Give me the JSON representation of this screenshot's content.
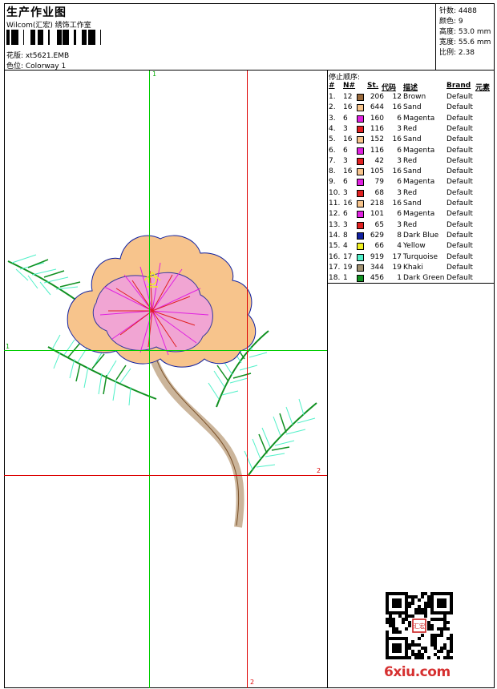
{
  "header": {
    "title": "生产作业图",
    "company": "Wilcom(汇宏) 绣饰工作室",
    "design_file": "花版: xt5621.EMB",
    "colorway": "色位: Colorway 1"
  },
  "stats": [
    {
      "label": "针数",
      "value": "4488"
    },
    {
      "label": "颜色",
      "value": "9"
    },
    {
      "label": "高度",
      "value": "53.0 mm"
    },
    {
      "label": "宽度",
      "value": "55.6 mm"
    },
    {
      "label": "比例",
      "value": "2.38"
    }
  ],
  "guides": {
    "v1_label": "1",
    "h1_label": "1",
    "h2_label": "2",
    "v2_label": "2",
    "colors": {
      "primary": "#00cc00",
      "secondary": "#dd0000"
    }
  },
  "stop_sequence": {
    "title": "停止顺序:",
    "headers": [
      "#",
      "N#",
      "St.",
      "代码",
      "描述",
      "Brand",
      "元素"
    ],
    "rows": [
      {
        "num": "1.",
        "n": "12",
        "color": "#9a6a3c",
        "st": "206",
        "code": "12",
        "desc": "Brown",
        "brand": "Default"
      },
      {
        "num": "2.",
        "n": "16",
        "color": "#f7c48c",
        "st": "644",
        "code": "16",
        "desc": "Sand",
        "brand": "Default"
      },
      {
        "num": "3.",
        "n": "6",
        "color": "#e020e0",
        "st": "160",
        "code": "6",
        "desc": "Magenta",
        "brand": "Default"
      },
      {
        "num": "4.",
        "n": "3",
        "color": "#e02020",
        "st": "116",
        "code": "3",
        "desc": "Red",
        "brand": "Default"
      },
      {
        "num": "5.",
        "n": "16",
        "color": "#f7c48c",
        "st": "152",
        "code": "16",
        "desc": "Sand",
        "brand": "Default"
      },
      {
        "num": "6.",
        "n": "6",
        "color": "#e020e0",
        "st": "116",
        "code": "6",
        "desc": "Magenta",
        "brand": "Default"
      },
      {
        "num": "7.",
        "n": "3",
        "color": "#e02020",
        "st": "42",
        "code": "3",
        "desc": "Red",
        "brand": "Default"
      },
      {
        "num": "8.",
        "n": "16",
        "color": "#f7c48c",
        "st": "105",
        "code": "16",
        "desc": "Sand",
        "brand": "Default"
      },
      {
        "num": "9.",
        "n": "6",
        "color": "#e020e0",
        "st": "79",
        "code": "6",
        "desc": "Magenta",
        "brand": "Default"
      },
      {
        "num": "10.",
        "n": "3",
        "color": "#e02020",
        "st": "68",
        "code": "3",
        "desc": "Red",
        "brand": "Default"
      },
      {
        "num": "11.",
        "n": "16",
        "color": "#f7c48c",
        "st": "218",
        "code": "16",
        "desc": "Sand",
        "brand": "Default"
      },
      {
        "num": "12.",
        "n": "6",
        "color": "#e020e0",
        "st": "101",
        "code": "6",
        "desc": "Magenta",
        "brand": "Default"
      },
      {
        "num": "13.",
        "n": "3",
        "color": "#e02020",
        "st": "65",
        "code": "3",
        "desc": "Red",
        "brand": "Default"
      },
      {
        "num": "14.",
        "n": "8",
        "color": "#1020a0",
        "st": "629",
        "code": "8",
        "desc": "Dark Blue",
        "brand": "Default"
      },
      {
        "num": "15.",
        "n": "4",
        "color": "#f0f020",
        "st": "66",
        "code": "4",
        "desc": "Yellow",
        "brand": "Default"
      },
      {
        "num": "16.",
        "n": "17",
        "color": "#50f0c8",
        "st": "919",
        "code": "17",
        "desc": "Turquoise",
        "brand": "Default"
      },
      {
        "num": "17.",
        "n": "19",
        "color": "#a09070",
        "st": "344",
        "code": "19",
        "desc": "Khaki",
        "brand": "Default"
      },
      {
        "num": "18.",
        "n": "1",
        "color": "#109020",
        "st": "456",
        "code": "1",
        "desc": "Dark Green",
        "brand": "Default"
      }
    ]
  },
  "qr": {
    "stamp_text": "汇宏"
  },
  "watermark": "6xiu.com"
}
